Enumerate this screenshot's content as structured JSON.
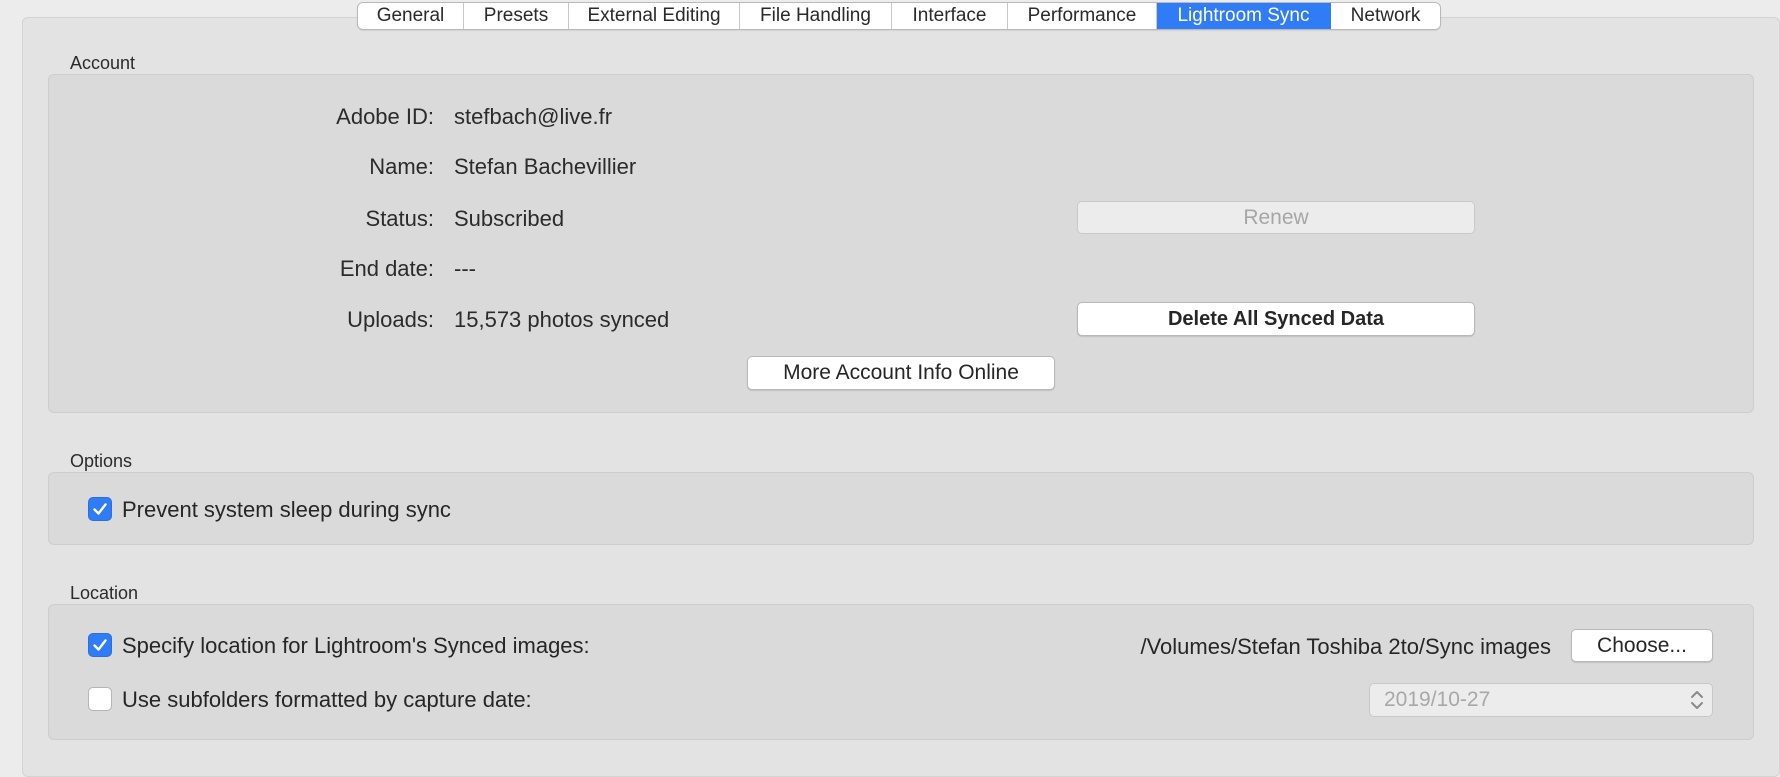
{
  "tabs": [
    {
      "label": "General",
      "active": false
    },
    {
      "label": "Presets",
      "active": false
    },
    {
      "label": "External Editing",
      "active": false
    },
    {
      "label": "File Handling",
      "active": false
    },
    {
      "label": "Interface",
      "active": false
    },
    {
      "label": "Performance",
      "active": false
    },
    {
      "label": "Lightroom Sync",
      "active": true
    },
    {
      "label": "Network",
      "active": false
    }
  ],
  "account": {
    "section_label": "Account",
    "adobe_id_label": "Adobe ID:",
    "adobe_id_value": "stefbach@live.fr",
    "name_label": "Name:",
    "name_value": "Stefan Bachevillier",
    "status_label": "Status:",
    "status_value": "Subscribed",
    "end_date_label": "End date:",
    "end_date_value": "---",
    "uploads_label": "Uploads:",
    "uploads_value": "15,573 photos synced",
    "renew_button": "Renew",
    "delete_button": "Delete All Synced Data",
    "more_info_button": "More Account Info Online"
  },
  "options": {
    "section_label": "Options",
    "prevent_sleep_label": "Prevent system sleep during sync",
    "prevent_sleep_checked": true
  },
  "location": {
    "section_label": "Location",
    "specify_location_label": "Specify location for Lightroom's Synced images:",
    "specify_location_checked": true,
    "path": "/Volumes/Stefan Toshiba 2to/Sync images",
    "choose_button": "Choose...",
    "subfolders_label": "Use subfolders formatted by capture date:",
    "subfolders_checked": false,
    "date_format_value": "2019/10-27"
  },
  "colors": {
    "accent": "#2f7cf6",
    "panel_bg": "#dadada",
    "window_bg": "#ececec"
  }
}
